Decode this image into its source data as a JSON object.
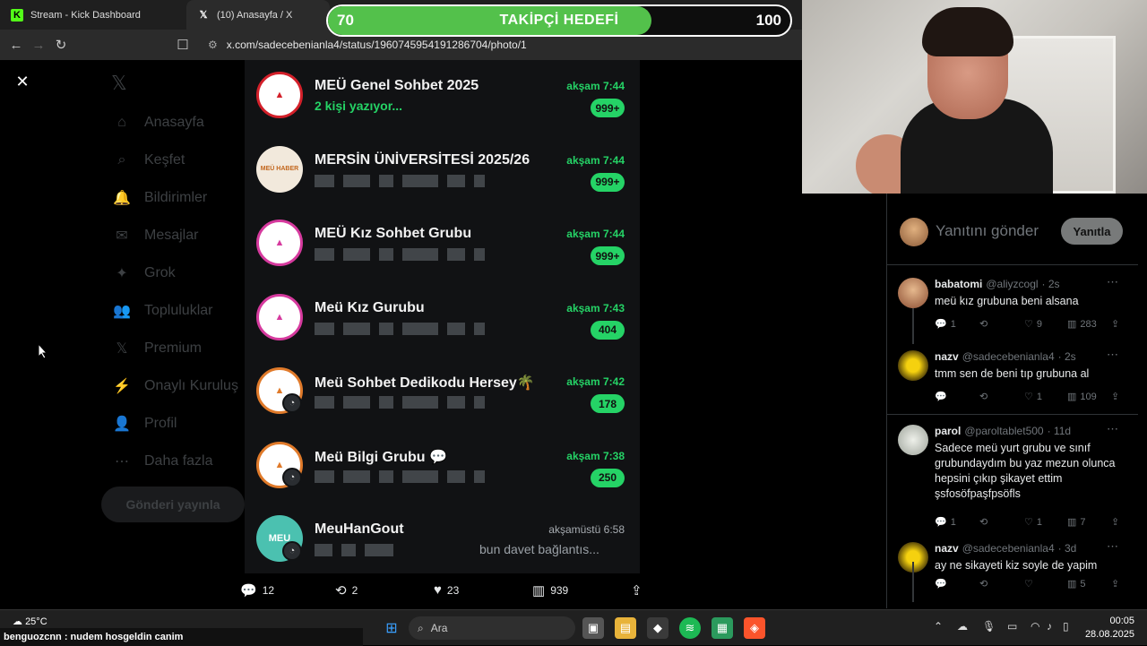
{
  "browser": {
    "tabs": [
      {
        "label": "Stream - Kick Dashboard",
        "icon": "kick-icon"
      },
      {
        "label": "(10) Anasayfa / X",
        "icon": "x-icon"
      }
    ],
    "url": "x.com/sadecebenianla4/status/1960745954191286704/photo/1"
  },
  "goal": {
    "title": "TAKİPÇİ HEDEFİ",
    "current": "70",
    "target": "100",
    "progress": 0.7,
    "color": "#53c14b"
  },
  "sidebar": {
    "items": [
      "Anasayfa",
      "Keşfet",
      "Bildirimler",
      "Mesajlar",
      "Grok",
      "Topluluklar",
      "Premium",
      "Onaylı Kuruluş",
      "Profil",
      "Daha fazla"
    ],
    "post_button": "Gönderi yayınla"
  },
  "chats": [
    {
      "name": "MEÜ Genel Sohbet 2025",
      "sub": "2 kişi yazıyor...",
      "typing": true,
      "time": "akşam 7:44",
      "badge": "999+",
      "avatar": "meu-seal-red"
    },
    {
      "name": "MERSİN ÜNİVERSİTESİ 2025/26",
      "sub": "",
      "typing": false,
      "time": "akşam 7:44",
      "badge": "999+",
      "avatar_label": "MEÜ HABER"
    },
    {
      "name": "MEÜ Kız Sohbet Grubu",
      "sub": "",
      "typing": false,
      "time": "akşam 7:44",
      "badge": "999+",
      "avatar": "meu-seal-pink"
    },
    {
      "name": "Meü Kız Gurubu",
      "sub": "",
      "typing": false,
      "time": "akşam 7:43",
      "badge": "404",
      "avatar": "meu-seal-pink"
    },
    {
      "name": "Meü Sohbet Dedikodu  Hersey🌴",
      "sub": "",
      "typing": false,
      "time": "akşam 7:42",
      "badge": "178",
      "avatar": "meu-seal-orange"
    },
    {
      "name": "Meü Bilgi Grubu 💬",
      "sub": "",
      "typing": false,
      "time": "akşam 7:38",
      "badge": "250",
      "avatar": "meu-seal-orange"
    },
    {
      "name": "MeuHanGout",
      "sub": "bun davet bağlantıs...",
      "typing": false,
      "time": "akşamüstü 6:58",
      "badge": "",
      "avatar_label": "MEU"
    }
  ],
  "tweet_actions": {
    "replies": "12",
    "reposts": "2",
    "likes": "23",
    "views": "939"
  },
  "composer": {
    "placeholder": "Yanıtını gönder",
    "button": "Yanıtla"
  },
  "replies": [
    {
      "name": "babatomi",
      "handle": "@aliyzcogl",
      "time": "· 2s",
      "text": "meü kız grubuna beni alsana",
      "reply": "1",
      "repost": "",
      "like": "9",
      "views": "283"
    },
    {
      "name": "nazv",
      "handle": "@sadecebenianla4",
      "time": "· 2s",
      "text": "tmm sen de beni tıp grubuna al",
      "reply": "",
      "repost": "",
      "like": "1",
      "views": "109"
    },
    {
      "name": "parol",
      "handle": "@paroltablet500",
      "time": "· 11d",
      "text": "Sadece meü yurt grubu ve sınıf grubundaydım bu yaz mezun olunca hepsini çıkıp şikayet ettim şsfosöfpaşfpsöfls",
      "reply": "1",
      "repost": "",
      "like": "1",
      "views": "7"
    },
    {
      "name": "nazv",
      "handle": "@sadecebenianla4",
      "time": "· 3d",
      "text": "ay ne sikayeti kiz soyle de yapim",
      "reply": "",
      "repost": "",
      "like": "",
      "views": "5"
    }
  ],
  "taskbar": {
    "temperature": "25°C",
    "chat_message": "benguozcnn : nudem hosgeldin canim",
    "search": "Ara",
    "time": "00:05",
    "date": "28.08.2025"
  }
}
